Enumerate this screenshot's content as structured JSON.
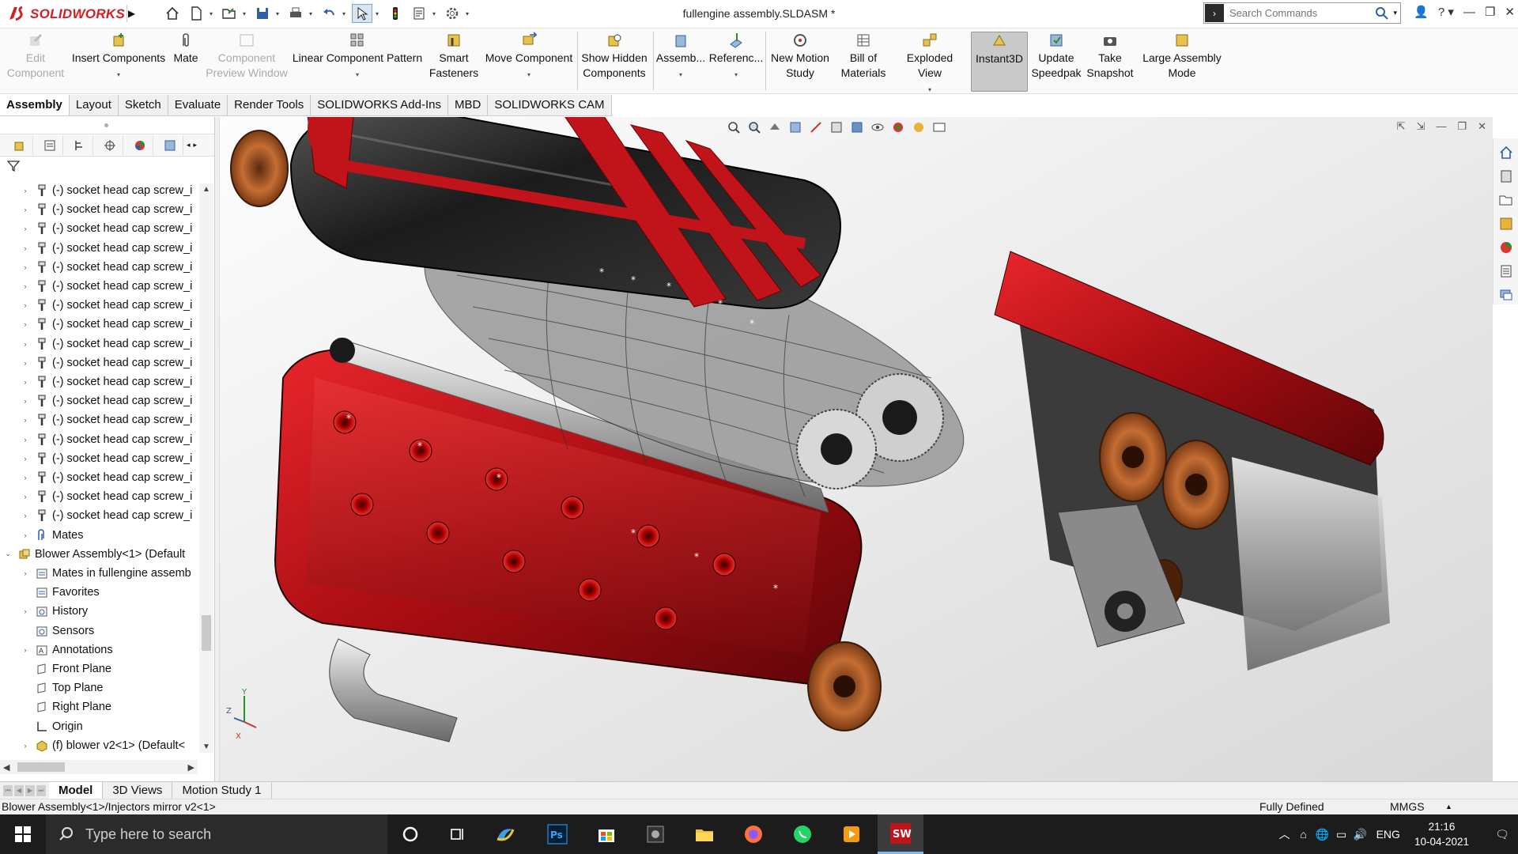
{
  "app": {
    "name": "SOLIDWORKS",
    "document_title": "fullengine assembly.SLDASM *"
  },
  "search": {
    "placeholder": "Search Commands"
  },
  "quick_access": [
    "home-icon",
    "new-icon",
    "open-icon",
    "save-icon",
    "print-icon",
    "undo-icon",
    "select-icon",
    "traffic-light-icon",
    "file-props-icon",
    "options-icon"
  ],
  "command_manager": {
    "edit_component": "Edit\nComponent",
    "insert_components": "Insert Components",
    "mate": "Mate",
    "component_preview_window": "Component\nPreview Window",
    "linear_component_pattern": "Linear Component Pattern",
    "smart_fasteners": "Smart\nFasteners",
    "move_component": "Move Component",
    "show_hidden_components": "Show Hidden\nComponents",
    "assembly_features": "Assemb...",
    "reference_geometry": "Referenc...",
    "new_motion_study": "New Motion\nStudy",
    "bill_of_materials": "Bill of\nMaterials",
    "exploded_view": "Exploded View",
    "instant3d": "Instant3D",
    "update_speedpak": "Update\nSpeedpak",
    "take_snapshot": "Take\nSnapshot",
    "large_assembly_mode": "Large Assembly\nMode"
  },
  "tabs": [
    "Assembly",
    "Layout",
    "Sketch",
    "Evaluate",
    "Render Tools",
    "SOLIDWORKS Add-Ins",
    "MBD",
    "SOLIDWORKS CAM"
  ],
  "active_tab": "Assembly",
  "feature_tree": {
    "screw_label": "(-) socket head cap screw_i",
    "screw_count": 18,
    "mates": "Mates",
    "blower_assembly": "Blower Assembly<1> (Default",
    "mates_in": "Mates in fullengine assemb",
    "favorites": "Favorites",
    "history": "History",
    "sensors": "Sensors",
    "annotations": "Annotations",
    "front_plane": "Front Plane",
    "top_plane": "Top Plane",
    "right_plane": "Right Plane",
    "origin": "Origin",
    "blower_v2": "(f) blower v2<1> (Default<"
  },
  "bottom_tabs": [
    "Model",
    "3D Views",
    "Motion Study 1"
  ],
  "active_bottom_tab": "Model",
  "status": {
    "selection_path": "Blower Assembly<1>/Injectors mirror v2<1>",
    "state": "Fully Defined",
    "units": "MMGS"
  },
  "taskbar": {
    "search_placeholder": "Type here to search",
    "language": "ENG",
    "time": "21:16",
    "date": "10-04-2021"
  },
  "colors": {
    "accent_red": "#d11f26",
    "engine_red": "#c0141a",
    "copper": "#b8652e"
  }
}
